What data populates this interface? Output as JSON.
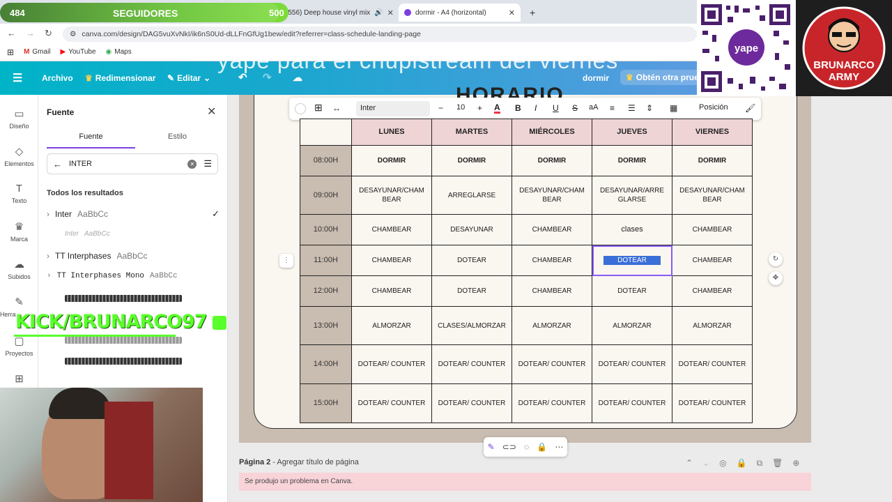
{
  "browser": {
    "tabs": [
      {
        "label": "(556) Deep house vinyl mix",
        "active": false
      },
      {
        "label": "dormir - A4 (horizontal)",
        "active": true
      }
    ],
    "url": "canva.com/design/DAG5vuXvNkI/ik6nS0Ud-dLLFnGfUg1bew/edit?referrer=class-schedule-landing-page",
    "bookmarks": [
      "Gmail",
      "YouTube",
      "Maps"
    ]
  },
  "canva_header": {
    "menu": [
      "Archivo",
      "Redimensionar",
      "Editar"
    ],
    "design_name": "dormir",
    "promo": "Obtén otra prue"
  },
  "overlay_text": "yape para el chupistream del viernes",
  "left_rail": [
    "Diseño",
    "Elementos",
    "Texto",
    "Marca",
    "Subidos",
    "Herra",
    "Proyectos"
  ],
  "font_panel": {
    "title": "Fuente",
    "tabs": [
      "Fuente",
      "Estilo"
    ],
    "search_value": "INTER",
    "results_heading": "Todos los resultados",
    "fonts": [
      {
        "name": "Inter",
        "sample": "AaBbCc",
        "checked": true
      },
      {
        "name": "Inter",
        "sample": "AaBbCc",
        "checked": false
      },
      {
        "name": "TT Interphases",
        "sample": "AaBbCc",
        "checked": false
      },
      {
        "name": "TT Interphases Mono",
        "sample": "AaBbCc",
        "checked": false
      }
    ]
  },
  "text_toolbar": {
    "font": "Inter",
    "size": "10",
    "position": "Posición"
  },
  "schedule": {
    "heading": "HORARIO",
    "days": [
      "LUNES",
      "MARTES",
      "MIÉRCOLES",
      "JUEVES",
      "VIERNES"
    ],
    "rows": [
      {
        "time": "08:00H",
        "cells": [
          "DORMIR",
          "DORMIR",
          "DORMIR",
          "DORMIR",
          "DORMIR"
        ]
      },
      {
        "time": "09:00H",
        "cells": [
          "DESAYUNAR/CHAMBEAR",
          "ARREGLARSE",
          "DESAYUNAR/CHAMBEAR",
          "DESAYUNAR/ARREGLARSE",
          "DESAYUNAR/CHAMBEAR"
        ]
      },
      {
        "time": "10:00H",
        "cells": [
          "CHAMBEAR",
          "DESAYUNAR",
          "CHAMBEAR",
          "clases",
          "CHAMBEAR"
        ]
      },
      {
        "time": "11:00H",
        "cells": [
          "CHAMBEAR",
          "DOTEAR",
          "CHAMBEAR",
          "DOTEAR",
          "CHAMBEAR"
        ]
      },
      {
        "time": "12:00H",
        "cells": [
          "CHAMBEAR",
          "DOTEAR",
          "CHAMBEAR",
          "DOTEAR",
          "CHAMBEAR"
        ]
      },
      {
        "time": "13:00H",
        "cells": [
          "ALMORZAR",
          "CLASES/ALMORZAR",
          "ALMORZAR",
          "ALMORZAR",
          "ALMORZAR"
        ]
      },
      {
        "time": "14:00H",
        "cells": [
          "DOTEAR/ COUNTER",
          "DOTEAR/ COUNTER",
          "DOTEAR/ COUNTER",
          "DOTEAR/ COUNTER",
          "DOTEAR/ COUNTER"
        ]
      },
      {
        "time": "15:00H",
        "cells": [
          "DOTEAR/ COUNTER",
          "DOTEAR/ COUNTER",
          "DOTEAR/ COUNTER",
          "DOTEAR/ COUNTER",
          "DOTEAR/ COUNTER"
        ]
      }
    ]
  },
  "page2": {
    "label": "Página 2",
    "add_title": "Agregar título de página"
  },
  "error_message": "Se produjo un problema en Canva.",
  "stream": {
    "followers_current": "484",
    "followers_label": "SEGUIDORES",
    "followers_goal": "500",
    "followers_progress": 0.968,
    "kick": "KICK/BRUNARCO97",
    "brand": [
      "BRUNARCO",
      "ARMY"
    ],
    "yape_label": "yape"
  }
}
